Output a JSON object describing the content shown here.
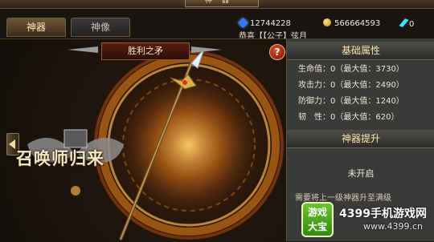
{
  "window": {
    "title": "神器"
  },
  "tabs": [
    {
      "label": "神器",
      "active": true
    },
    {
      "label": "神像",
      "active": false
    }
  ],
  "currencies": {
    "diamonds": "12744228",
    "gold": "566664593",
    "crystals": "0"
  },
  "notice": "恭喜【【公子】弦月",
  "weapon": {
    "name": "胜利之矛"
  },
  "help_label": "?",
  "base_attributes": {
    "title": "基础属性",
    "rows": [
      {
        "label": "生命值：0（最大值：3730）"
      },
      {
        "label": "攻击力：0（最大值：2490）"
      },
      {
        "label": "防御力：0（最大值：1240）"
      },
      {
        "label": "韧　性：0（最大值：620）"
      }
    ]
  },
  "upgrade": {
    "title": "神器提升",
    "status": "未开启",
    "requirement": "需要将上一级神器升至满级"
  },
  "logo_text": "召唤师归来",
  "watermark": {
    "badge_line1": "游戏",
    "badge_line2": "大宝",
    "main": "4399手机游戏网",
    "url": "www.4399.cn"
  },
  "colors": {
    "accent": "#ffe4a8",
    "ring": "#ff8a1a",
    "panel_bg": "#3a3a38"
  },
  "icons": [
    "diamond-icon",
    "gold-coin-icon",
    "crystal-icon",
    "help-icon",
    "left-arrow-icon",
    "spear-icon"
  ]
}
